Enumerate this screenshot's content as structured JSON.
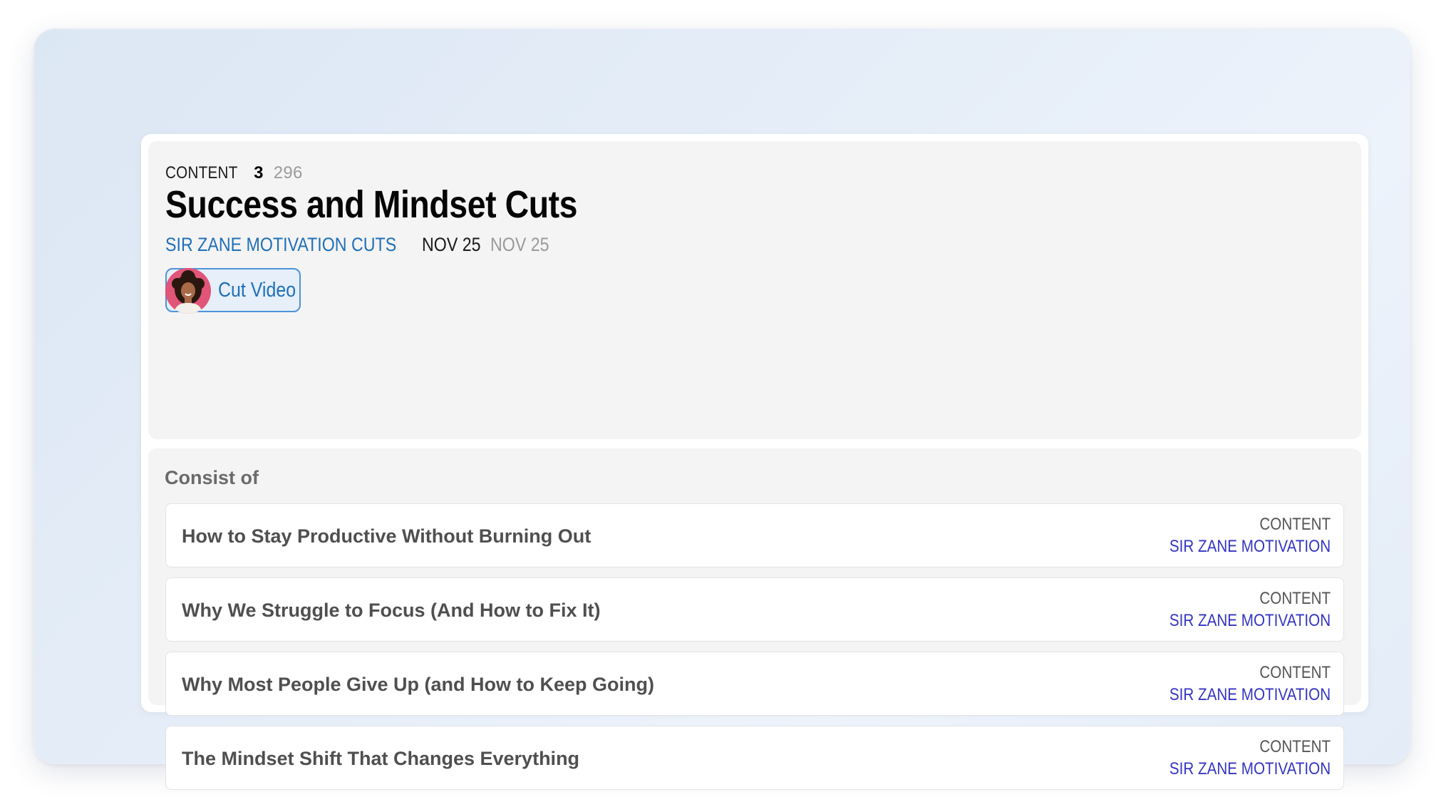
{
  "header": {
    "kind_label": "CONTENT",
    "count": "3",
    "total": "296",
    "title": "Success and Mindset Cuts",
    "channel": "SIR ZANE MOTIVATION CUTS",
    "date_primary": "NOV 25",
    "date_secondary": "NOV 25"
  },
  "action_chip": {
    "label": "Cut Video",
    "avatar_icon": "avatar-woman-portrait-icon"
  },
  "list": {
    "heading": "Consist of",
    "items": [
      {
        "title": "How to Stay Productive Without Burning Out",
        "kind": "CONTENT",
        "channel": "SIR ZANE MOTIVATION"
      },
      {
        "title": "Why We Struggle to Focus (And How to Fix It)",
        "kind": "CONTENT",
        "channel": "SIR ZANE MOTIVATION"
      },
      {
        "title": "Why Most People Give Up (and How to Keep Going)",
        "kind": "CONTENT",
        "channel": "SIR ZANE MOTIVATION"
      },
      {
        "title": "The Mindset Shift That Changes Everything",
        "kind": "CONTENT",
        "channel": "SIR ZANE MOTIVATION"
      }
    ]
  },
  "colors": {
    "link_blue": "#1f6fb8",
    "channel_indigo": "#3434c4",
    "chip_border": "#4d93d9",
    "avatar_bg": "#e05578"
  }
}
